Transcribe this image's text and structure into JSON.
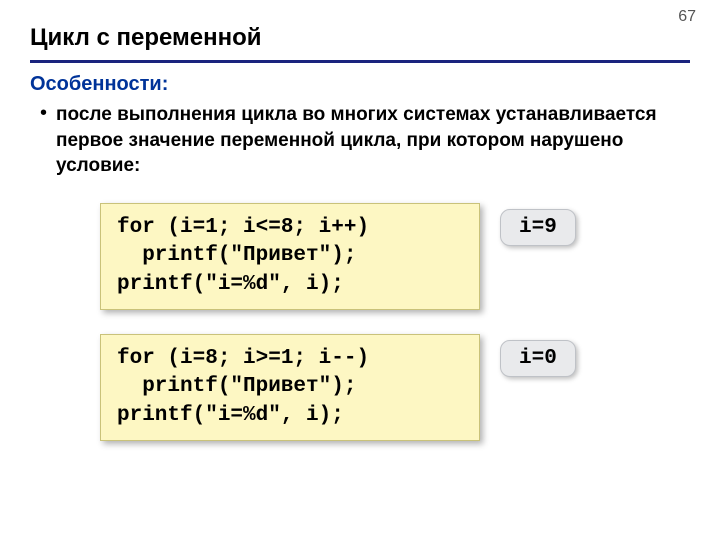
{
  "page_number": "67",
  "title": "Цикл с переменной",
  "subtitle": "Особенности:",
  "bullet": "после выполнения цикла во многих системах устанавливается первое значение переменной цикла, при котором нарушено условие:",
  "examples": [
    {
      "code": "for (i=1; i<=8; i++)\n  printf(\"Привет\");\nprintf(\"i=%d\", i);",
      "result": "i=9"
    },
    {
      "code": "for (i=8; i>=1; i--)\n  printf(\"Привет\");\nprintf(\"i=%d\", i);",
      "result": "i=0"
    }
  ]
}
